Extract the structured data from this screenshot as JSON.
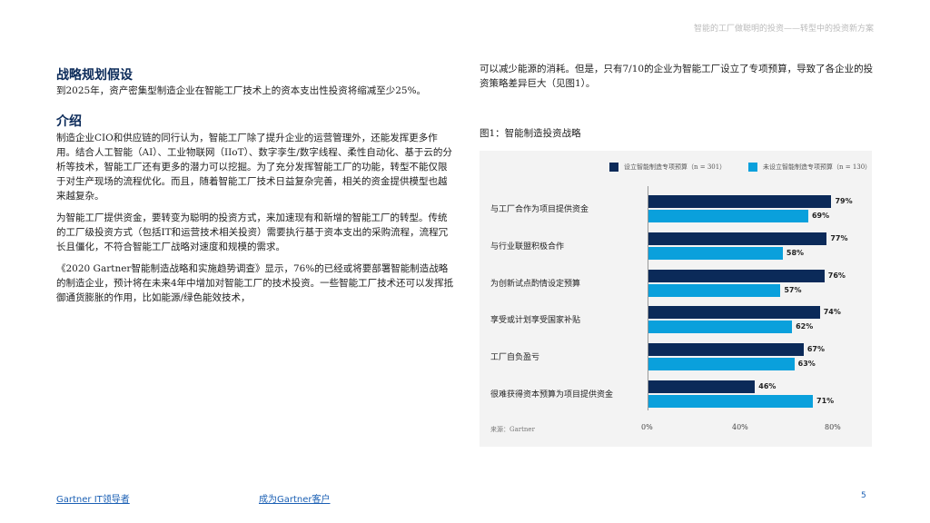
{
  "header": {
    "title": "智能的工厂做聪明的投资——转型中的投资新方案"
  },
  "left": {
    "h1": "战略规划假设",
    "p1": "到2025年，资产密集型制造企业在智能工厂技术上的资本支出性投资将缩减至少25%。",
    "h2": "介绍",
    "p2": "制造企业CIO和供应链的同行认为，智能工厂除了提升企业的运营管理外，还能发挥更多作用。结合人工智能（AI）、工业物联网（IIoT）、数字孪生/数字线程、柔性自动化、基于云的分析等技术，智能工厂还有更多的潜力可以挖掘。为了充分发挥智能工厂的功能，转型不能仅限于对生产现场的流程优化。而且，随着智能工厂技术日益复杂完善，相关的资金提供模型也越来越复杂。",
    "p3": "为智能工厂提供资金，要转变为聪明的投资方式，来加速现有和新增的智能工厂的转型。传统的工厂级投资方式（包括IT和运营技术相关投资）需要执行基于资本支出的采购流程，流程冗长且僵化，不符合智能工厂战略对速度和规模的需求。",
    "p4": "《2020 Gartner智能制造战略和实施趋势调查》显示，76%的已经或将要部署智能制造战略的制造企业，预计将在未来4年中增加对智能工厂的技术投资。一些智能工厂技术还可以发挥抵御通货膨胀的作用，比如能源/绿色能效技术，"
  },
  "right": {
    "p1": "可以减少能源的消耗。但是，只有7/10的企业为智能工厂设立了专项预算，导致了各企业的投资策略差异巨大（见图1）。",
    "fig_title": "图1：智能制造投资战略",
    "source": "来源：Gartner"
  },
  "chart_data": {
    "type": "bar",
    "orientation": "horizontal",
    "title": "图1：智能制造投资战略",
    "categories": [
      "与工厂合作为项目提供资金",
      "与行业联盟积极合作",
      "为创新试点酌情设定预算",
      "享受或计划享受国家补贴",
      "工厂自负盈亏",
      "很难获得资本预算为项目提供资金"
    ],
    "series": [
      {
        "name": "设立智能制造专项预算（n = 301）",
        "color": "#0b2a59",
        "values": [
          79,
          77,
          76,
          74,
          67,
          46
        ]
      },
      {
        "name": "未设立智能制造专项预算（n = 130）",
        "color": "#0aa0dc",
        "values": [
          69,
          58,
          57,
          62,
          63,
          71
        ]
      }
    ],
    "xticks": [
      "0%",
      "40%",
      "80%"
    ],
    "xlim": [
      0,
      80
    ],
    "legend": "top-right"
  },
  "footer": {
    "link1": "Gartner IT领导者",
    "link2": "成为Gartner客户",
    "page": "5"
  }
}
